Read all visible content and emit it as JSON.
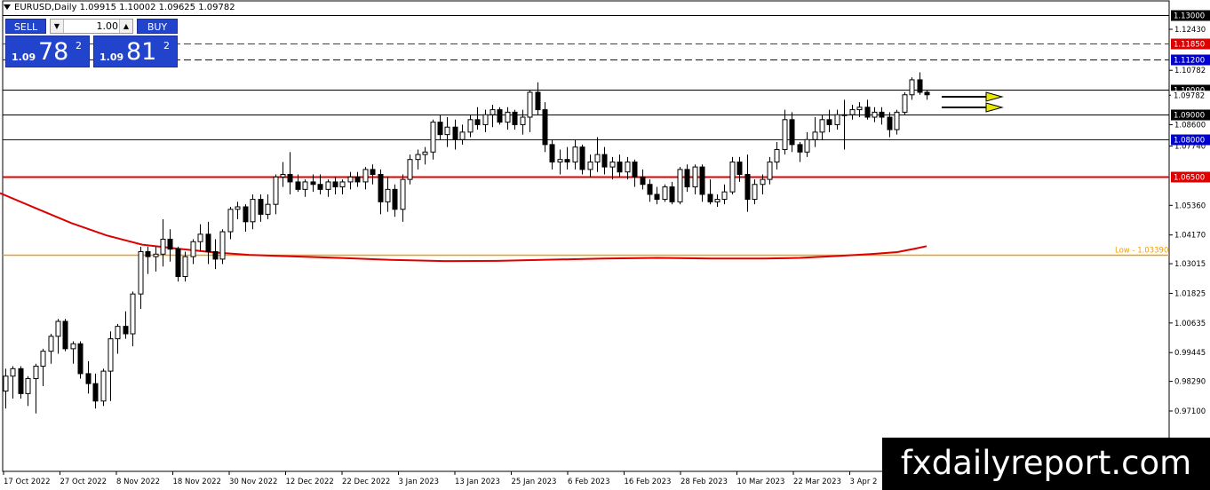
{
  "header": {
    "symbol_title": "EURUSD,Daily  1.09915 1.10002 1.09625 1.09782"
  },
  "trade_panel": {
    "sell_label": "SELL",
    "buy_label": "BUY",
    "lot_value": "1.00",
    "lot_down_icon": "triangle-down",
    "lot_up_icon": "triangle-up",
    "sell_price_prefix": "1.09",
    "sell_price_big": "78",
    "sell_price_sup": "2",
    "buy_price_prefix": "1.09",
    "buy_price_big": "81",
    "buy_price_sup": "2",
    "button_color": "#2244cc"
  },
  "watermark": {
    "text": "fxdailyreport.com",
    "color": "#ffffff",
    "background": "#000000"
  },
  "chart_data": {
    "type": "candlestick",
    "symbol": "EURUSD",
    "timeframe": "Daily",
    "ylim": [
      0.962,
      1.131
    ],
    "price_axis_ticks": [
      "1.12430",
      "1.10782",
      "1.09782",
      "1.08600",
      "1.07740",
      "1.05360",
      "1.04170",
      "1.03015",
      "1.01825",
      "1.00635",
      "0.99445",
      "0.98290",
      "0.97100"
    ],
    "time_axis_labels": [
      "17 Oct 2022",
      "27 Oct 2022",
      "8 Nov 2022",
      "18 Nov 2022",
      "30 Nov 2022",
      "12 Dec 2022",
      "22 Dec 2022",
      "3 Jan 2023",
      "13 Jan 2023",
      "25 Jan 2023",
      "6 Feb 2023",
      "16 Feb 2023",
      "28 Feb 2023",
      "10 Mar 2023",
      "22 Mar 2023",
      "3 Apr 2"
    ],
    "horizontal_lines": [
      {
        "price": 1.13,
        "label": "1.13000",
        "color": "#000000",
        "style": "solid",
        "label_bg": "#000000"
      },
      {
        "price": 1.1185,
        "label": "1.11850",
        "color": "#dd0000",
        "style": "dashed",
        "label_bg": "#dd0000"
      },
      {
        "price": 1.112,
        "label": "1.11200",
        "color": "#0000cc",
        "style": "dashed",
        "label_bg": "#0000cc"
      },
      {
        "price": 1.1,
        "label": "1.10000",
        "color": "#000000",
        "style": "solid",
        "label_bg": "#000000"
      },
      {
        "price": 1.09,
        "label": "1.09000",
        "color": "#000000",
        "style": "solid",
        "label_bg": "#000000"
      },
      {
        "price": 1.08,
        "label": "1.08000",
        "color": "#0000cc",
        "style": "solid",
        "label_bg": "#0000cc"
      },
      {
        "price": 1.065,
        "label": "1.06500",
        "color": "#dd0000",
        "style": "solid",
        "label_bg": "#dd0000"
      },
      {
        "price": 1.0339,
        "label": "Low - 1.03390",
        "color": "#f0a000",
        "style": "solid",
        "label_bg": ""
      }
    ],
    "current_price": {
      "price": 1.09782,
      "label": "1.09782"
    },
    "moving_average": {
      "color": "#dd0000",
      "points": [
        [
          0,
          1.0585
        ],
        [
          40,
          1.0525
        ],
        [
          80,
          1.0465
        ],
        [
          120,
          1.0415
        ],
        [
          160,
          1.0378
        ],
        [
          200,
          1.0362
        ],
        [
          240,
          1.0347
        ],
        [
          280,
          1.0337
        ],
        [
          320,
          1.0332
        ],
        [
          380,
          1.0325
        ],
        [
          440,
          1.0317
        ],
        [
          500,
          1.0312
        ],
        [
          560,
          1.0313
        ],
        [
          620,
          1.0318
        ],
        [
          680,
          1.0322
        ],
        [
          740,
          1.0325
        ],
        [
          800,
          1.0322
        ],
        [
          860,
          1.0322
        ],
        [
          900,
          1.0325
        ],
        [
          940,
          1.0332
        ],
        [
          980,
          1.034
        ],
        [
          1010,
          1.0348
        ],
        [
          1030,
          1.0362
        ],
        [
          1043,
          1.0372
        ]
      ]
    },
    "candles": [
      [
        0.979,
        0.988,
        0.972,
        0.985
      ],
      [
        0.985,
        0.989,
        0.976,
        0.988
      ],
      [
        0.988,
        0.989,
        0.976,
        0.978
      ],
      [
        0.978,
        0.985,
        0.973,
        0.984
      ],
      [
        0.984,
        0.99,
        0.97,
        0.989
      ],
      [
        0.989,
        0.996,
        0.981,
        0.995
      ],
      [
        0.995,
        1.002,
        0.99,
        1.001
      ],
      [
        1.001,
        1.008,
        0.994,
        1.007
      ],
      [
        1.007,
        1.008,
        0.995,
        0.996
      ],
      [
        0.996,
        0.999,
        0.99,
        0.998
      ],
      [
        0.998,
        0.999,
        0.984,
        0.986
      ],
      [
        0.986,
        0.991,
        0.978,
        0.982
      ],
      [
        0.982,
        0.986,
        0.972,
        0.975
      ],
      [
        0.975,
        0.988,
        0.973,
        0.987
      ],
      [
        0.987,
        1.003,
        0.975,
        1.0
      ],
      [
        1.0,
        1.006,
        0.994,
        1.005
      ],
      [
        1.005,
        1.011,
        1.0,
        1.002
      ],
      [
        1.002,
        1.019,
        0.997,
        1.018
      ],
      [
        1.018,
        1.037,
        1.012,
        1.035
      ],
      [
        1.035,
        1.037,
        1.026,
        1.033
      ],
      [
        1.033,
        1.037,
        1.027,
        1.034
      ],
      [
        1.034,
        1.048,
        1.029,
        1.04
      ],
      [
        1.04,
        1.044,
        1.031,
        1.036
      ],
      [
        1.036,
        1.037,
        1.023,
        1.025
      ],
      [
        1.025,
        1.035,
        1.023,
        1.033
      ],
      [
        1.033,
        1.04,
        1.03,
        1.039
      ],
      [
        1.039,
        1.046,
        1.035,
        1.042
      ],
      [
        1.042,
        1.047,
        1.03,
        1.035
      ],
      [
        1.035,
        1.04,
        1.028,
        1.032
      ],
      [
        1.032,
        1.044,
        1.03,
        1.043
      ],
      [
        1.043,
        1.053,
        1.04,
        1.052
      ],
      [
        1.052,
        1.055,
        1.048,
        1.053
      ],
      [
        1.053,
        1.054,
        1.043,
        1.047
      ],
      [
        1.047,
        1.058,
        1.044,
        1.056
      ],
      [
        1.056,
        1.058,
        1.047,
        1.05
      ],
      [
        1.05,
        1.058,
        1.048,
        1.054
      ],
      [
        1.054,
        1.066,
        1.05,
        1.065
      ],
      [
        1.065,
        1.071,
        1.061,
        1.066
      ],
      [
        1.066,
        1.075,
        1.058,
        1.063
      ],
      [
        1.063,
        1.066,
        1.059,
        1.06
      ],
      [
        1.06,
        1.064,
        1.057,
        1.063
      ],
      [
        1.063,
        1.066,
        1.059,
        1.062
      ],
      [
        1.062,
        1.066,
        1.058,
        1.06
      ],
      [
        1.06,
        1.064,
        1.057,
        1.063
      ],
      [
        1.063,
        1.065,
        1.058,
        1.061
      ],
      [
        1.061,
        1.064,
        1.058,
        1.063
      ],
      [
        1.063,
        1.067,
        1.06,
        1.065
      ],
      [
        1.065,
        1.067,
        1.061,
        1.063
      ],
      [
        1.063,
        1.069,
        1.06,
        1.068
      ],
      [
        1.068,
        1.07,
        1.062,
        1.066
      ],
      [
        1.066,
        1.068,
        1.05,
        1.055
      ],
      [
        1.055,
        1.065,
        1.051,
        1.06
      ],
      [
        1.06,
        1.062,
        1.049,
        1.052
      ],
      [
        1.052,
        1.066,
        1.047,
        1.064
      ],
      [
        1.064,
        1.074,
        1.062,
        1.072
      ],
      [
        1.072,
        1.076,
        1.068,
        1.074
      ],
      [
        1.074,
        1.077,
        1.07,
        1.075
      ],
      [
        1.075,
        1.088,
        1.072,
        1.087
      ],
      [
        1.087,
        1.09,
        1.08,
        1.082
      ],
      [
        1.082,
        1.089,
        1.077,
        1.085
      ],
      [
        1.085,
        1.088,
        1.076,
        1.08
      ],
      [
        1.08,
        1.086,
        1.078,
        1.083
      ],
      [
        1.083,
        1.09,
        1.081,
        1.088
      ],
      [
        1.088,
        1.093,
        1.084,
        1.086
      ],
      [
        1.086,
        1.092,
        1.083,
        1.09
      ],
      [
        1.09,
        1.094,
        1.085,
        1.092
      ],
      [
        1.092,
        1.093,
        1.086,
        1.087
      ],
      [
        1.087,
        1.093,
        1.084,
        1.091
      ],
      [
        1.091,
        1.092,
        1.084,
        1.086
      ],
      [
        1.086,
        1.092,
        1.082,
        1.089
      ],
      [
        1.089,
        1.1,
        1.083,
        1.099
      ],
      [
        1.099,
        1.103,
        1.09,
        1.092
      ],
      [
        1.092,
        1.095,
        1.075,
        1.078
      ],
      [
        1.078,
        1.08,
        1.068,
        1.071
      ],
      [
        1.071,
        1.076,
        1.066,
        1.072
      ],
      [
        1.072,
        1.077,
        1.068,
        1.071
      ],
      [
        1.071,
        1.08,
        1.068,
        1.077
      ],
      [
        1.077,
        1.078,
        1.066,
        1.068
      ],
      [
        1.068,
        1.074,
        1.065,
        1.071
      ],
      [
        1.071,
        1.081,
        1.067,
        1.074
      ],
      [
        1.074,
        1.077,
        1.066,
        1.069
      ],
      [
        1.069,
        1.073,
        1.064,
        1.071
      ],
      [
        1.071,
        1.074,
        1.065,
        1.067
      ],
      [
        1.067,
        1.073,
        1.064,
        1.071
      ],
      [
        1.071,
        1.072,
        1.061,
        1.065
      ],
      [
        1.065,
        1.068,
        1.06,
        1.062
      ],
      [
        1.062,
        1.064,
        1.055,
        1.058
      ],
      [
        1.058,
        1.061,
        1.054,
        1.056
      ],
      [
        1.056,
        1.062,
        1.055,
        1.061
      ],
      [
        1.061,
        1.063,
        1.054,
        1.055
      ],
      [
        1.055,
        1.069,
        1.054,
        1.068
      ],
      [
        1.068,
        1.07,
        1.059,
        1.061
      ],
      [
        1.061,
        1.07,
        1.058,
        1.069
      ],
      [
        1.069,
        1.07,
        1.055,
        1.058
      ],
      [
        1.058,
        1.064,
        1.054,
        1.055
      ],
      [
        1.055,
        1.058,
        1.053,
        1.056
      ],
      [
        1.056,
        1.062,
        1.054,
        1.059
      ],
      [
        1.059,
        1.073,
        1.058,
        1.071
      ],
      [
        1.071,
        1.073,
        1.063,
        1.066
      ],
      [
        1.066,
        1.074,
        1.051,
        1.056
      ],
      [
        1.056,
        1.064,
        1.054,
        1.062
      ],
      [
        1.062,
        1.066,
        1.058,
        1.064
      ],
      [
        1.064,
        1.073,
        1.062,
        1.071
      ],
      [
        1.071,
        1.079,
        1.068,
        1.076
      ],
      [
        1.076,
        1.092,
        1.074,
        1.088
      ],
      [
        1.088,
        1.091,
        1.075,
        1.078
      ],
      [
        1.078,
        1.079,
        1.071,
        1.075
      ],
      [
        1.075,
        1.083,
        1.073,
        1.08
      ],
      [
        1.08,
        1.089,
        1.077,
        1.083
      ],
      [
        1.083,
        1.09,
        1.08,
        1.088
      ],
      [
        1.088,
        1.092,
        1.083,
        1.086
      ],
      [
        1.086,
        1.092,
        1.084,
        1.09
      ],
      [
        1.09,
        1.096,
        1.076,
        1.09
      ],
      [
        1.09,
        1.094,
        1.088,
        1.092
      ],
      [
        1.092,
        1.095,
        1.089,
        1.093
      ],
      [
        1.093,
        1.096,
        1.088,
        1.089
      ],
      [
        1.089,
        1.093,
        1.087,
        1.091
      ],
      [
        1.091,
        1.093,
        1.086,
        1.089
      ],
      [
        1.089,
        1.091,
        1.081,
        1.084
      ],
      [
        1.084,
        1.092,
        1.082,
        1.091
      ],
      [
        1.091,
        1.099,
        1.09,
        1.098
      ],
      [
        1.098,
        1.105,
        1.096,
        1.104
      ],
      [
        1.104,
        1.107,
        1.098,
        1.099
      ],
      [
        1.099,
        1.1,
        1.096,
        1.098
      ]
    ],
    "annotation": {
      "type": "double-arrow",
      "color": "#e8e800",
      "direction": "right"
    }
  }
}
